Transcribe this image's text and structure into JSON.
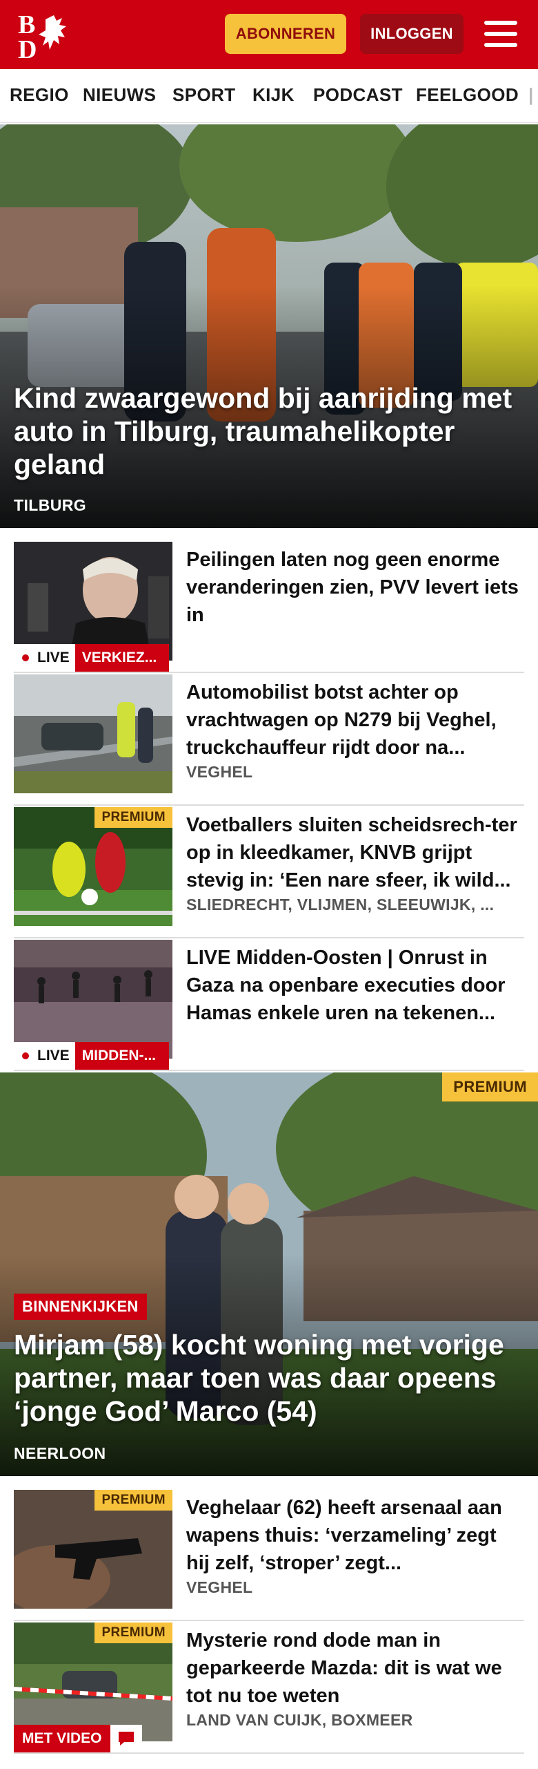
{
  "header": {
    "logo_alt": "BD",
    "subscribe_label": "ABONNEREN",
    "login_label": "INLOGGEN"
  },
  "nav": {
    "items": [
      "REGIO",
      "NIEUWS",
      "SPORT",
      "KIJK",
      "PODCAST",
      "FEELGOOD"
    ]
  },
  "hero": {
    "title": "Kind zwaargewond bij aanrijding met auto in Tilburg, traumahelikopter geland",
    "location": "TILBURG"
  },
  "articles": [
    {
      "title": "Peilingen laten nog geen enorme veranderingen zien, PVV levert iets in",
      "live_label": "LIVE",
      "category": "VERKIEZ..."
    },
    {
      "title": "Automobilist botst achter op vrachtwagen op N279 bij Veghel, truckchauffeur rijdt door na...",
      "location": "VEGHEL"
    },
    {
      "title": "Voetballers sluiten scheidsrech-ter op in kleedkamer, KNVB grijpt stevig in: ‘Een nare sfeer, ik wild...",
      "location": "SLIEDRECHT, VLIJMEN, SLEEUWIJK, ...",
      "premium": "PREMIUM"
    },
    {
      "title": "LIVE Midden-Oosten | Onrust in Gaza na openbare executies door Hamas enkele uren na tekenen...",
      "live_label": "LIVE",
      "category": "MIDDEN-..."
    }
  ],
  "feature": {
    "premium": "PREMIUM",
    "category": "BINNENKIJKEN",
    "title": "Mirjam (58) kocht woning met vorige partner, maar toen was daar opeens ‘jonge God’ Marco (54)",
    "location": "NEERLOON"
  },
  "articles2": [
    {
      "title": "Veghelaar (62) heeft arsenaal aan wapens thuis: ‘verzameling’ zegt hij zelf, ‘stroper’ zegt...",
      "location": "VEGHEL",
      "premium": "PREMIUM"
    },
    {
      "title": "Mysterie rond dode man in geparkeerde Mazda: dit is wat we tot nu toe weten",
      "location": "LAND VAN CUIJK, BOXMEER",
      "premium": "PREMIUM",
      "video_label": "MET VIDEO"
    }
  ],
  "colors": {
    "brand_red": "#cc0010",
    "accent_yellow": "#f7c23b"
  }
}
